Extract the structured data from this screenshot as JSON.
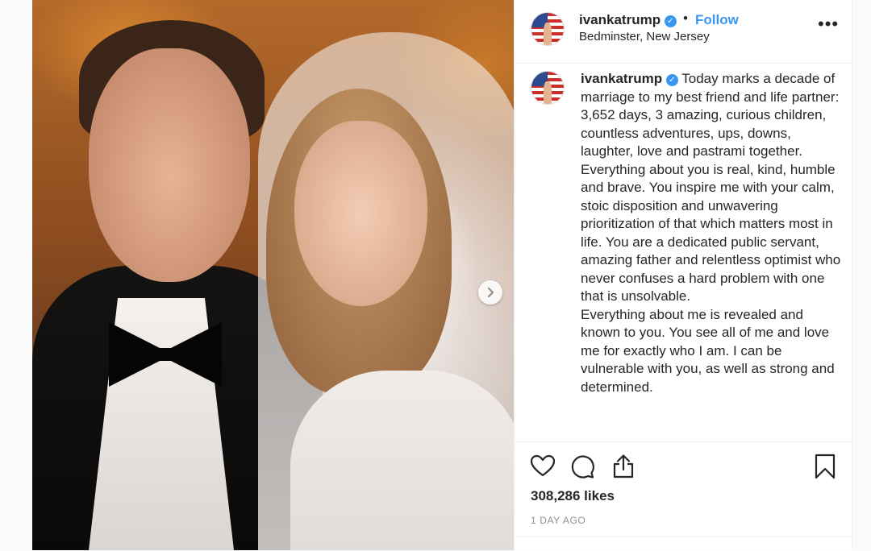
{
  "post": {
    "username": "ivankatrump",
    "follow_label": "Follow",
    "separator": "•",
    "location": "Bedminster, New Jersey",
    "more_label": "•••",
    "verified_mark": "✓"
  },
  "caption": {
    "paragraphs": [
      "Today marks a decade of marriage to my best friend and life partner: 3,652 days, 3 amazing, curious children, countless adventures, ups, downs, laughter, love and pastrami together.",
      "Everything about you is real, kind, humble and brave. You inspire me with your calm, stoic disposition and unwavering prioritization of that which matters most in life. You are a dedicated public servant, amazing father and relentless optimist who never confuses a hard problem with one that is unsolvable.",
      "Everything about me is revealed and known to you. You see all of me and love me for exactly who I am. I can be vulnerable with you, as well as strong and determined."
    ]
  },
  "stats": {
    "likes": "308,286 likes",
    "time_ago": "1 DAY AGO"
  },
  "icons": {
    "like": "heart-icon",
    "comment": "comment-icon",
    "share": "share-icon",
    "save": "bookmark-icon",
    "next": "chevron-right-icon"
  },
  "colors": {
    "accent": "#3897f0",
    "text": "#262626",
    "muted": "#8e8e8e"
  }
}
